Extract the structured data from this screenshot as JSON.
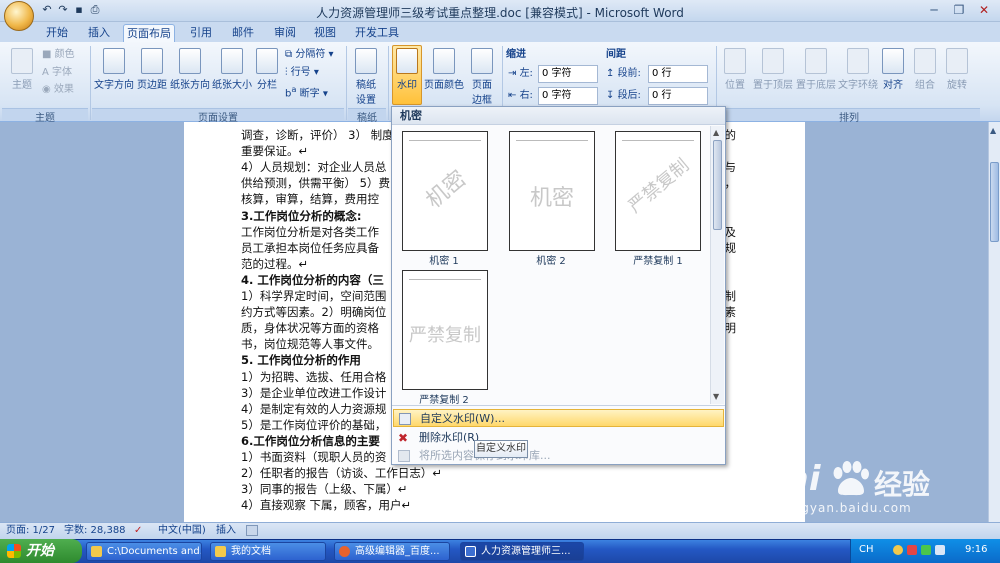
{
  "window": {
    "title": "人力资源管理师三级考试重点整理.doc [兼容模式] - Microsoft Word"
  },
  "qat": {
    "undo": "↶",
    "redo": "↷",
    "save": "▪",
    "print": "⎙"
  },
  "tabs": [
    "开始",
    "插入",
    "页面布局",
    "引用",
    "邮件",
    "审阅",
    "视图",
    "开发工具"
  ],
  "ribbon": {
    "theme": {
      "label": "主题",
      "colors": "颜色",
      "fonts": "字体",
      "effects": "效果",
      "group": "主题"
    },
    "page_setup": {
      "text_dir": "文字方向",
      "margins": "页边距",
      "orientation": "纸张方向",
      "size": "纸张大小",
      "columns": "分栏",
      "breaks": "分隔符",
      "line_numbers": "行号",
      "hyphenation": "断字",
      "group": "页面设置"
    },
    "manuscript": {
      "settings": "稿纸\n设置",
      "group": "稿纸"
    },
    "background": {
      "watermark": "水印",
      "page_color": "页面颜色",
      "page_border": "页面\n边框"
    },
    "paragraph": {
      "indent_label": "缩进",
      "left": "左:",
      "left_value": "0 字符",
      "right": "右:",
      "right_value": "0 字符",
      "spacing_label": "间距",
      "before": "段前:",
      "before_value": "0 行",
      "after": "段后:",
      "after_value": "0 行"
    },
    "arrange": {
      "position": "位置",
      "bring_front": "置于顶层",
      "send_back": "置于底层",
      "text_wrap": "文字环绕",
      "align": "对齐",
      "group_btn": "组合",
      "rotate": "旋转",
      "group": "排列"
    }
  },
  "document": {
    "lines": [
      {
        "text": "调查，诊断，评价） 3） 制度",
        "tail": "规的",
        "bold": false
      },
      {
        "text": "重要保证。↵",
        "tail": "",
        "bold": false
      },
      {
        "text": "4）人员规划：对企业人员总",
        "tail": "求与",
        "bold": false
      },
      {
        "text": "供给预测，供需平衡） 5）费",
        "tail": "算，",
        "bold": false
      },
      {
        "text": "核算，审算，结算，费用控",
        "tail": "",
        "bold": false
      },
      {
        "text": "3.工作岗位分析的概念:",
        "tail": "",
        "bold": true
      },
      {
        "text": " 工作岗位分析是对各类工作",
        "tail": "以及",
        "bold": false
      },
      {
        "text": "员工承担本岗位任务应具备",
        "tail": "事规",
        "bold": false
      },
      {
        "text": "范的过程。↵",
        "tail": "",
        "bold": false
      },
      {
        "text": "4. 工作岗位分析的内容（三",
        "tail": "",
        "bold": true
      },
      {
        "text": "1）科学界定时间，空间范围",
        "tail": "和制",
        "bold": false
      },
      {
        "text": "约方式等因素。2）明确岗位",
        "tail": "理素",
        "bold": false
      },
      {
        "text": "质，身体状况等方面的资格",
        "tail": "说明",
        "bold": false
      },
      {
        "text": "书，岗位规范等人事文件。",
        "tail": "",
        "bold": false
      },
      {
        "text": "5. 工作岗位分析的作用",
        "tail": "",
        "bold": true
      },
      {
        "text": "1）为招聘、选拔、任用合格",
        "tail": "",
        "bold": false
      },
      {
        "text": "3）是企业单位改进工作设计",
        "tail": "",
        "bold": false
      },
      {
        "text": "4）是制定有效的人力资源规",
        "tail": "",
        "bold": false
      },
      {
        "text": "5）是工作岗位评价的基础，",
        "tail": "",
        "bold": false
      },
      {
        "text": "6.工作岗位分析信息的主要",
        "tail": "",
        "bold": true
      },
      {
        "text": "1）书面资料（现职人员的资",
        "tail": "",
        "bold": false
      },
      {
        "text": "2）任职者的报告（访谈、工作日志）↵",
        "tail": "",
        "bold": false
      },
      {
        "text": "3）同事的报告（上级、下属）↵",
        "tail": "",
        "bold": false
      },
      {
        "text": "4）直接观察          下属，顾客，用户↵",
        "tail": "",
        "bold": false
      }
    ]
  },
  "watermark_menu": {
    "header": "机密",
    "items": [
      {
        "caption": "机密 1",
        "watermark": "机密",
        "diagonal": true
      },
      {
        "caption": "机密 2",
        "watermark": "机密",
        "diagonal": false
      },
      {
        "caption": "严禁复制 1",
        "watermark": "严禁复制",
        "diagonal": true
      },
      {
        "caption": "严禁复制 2",
        "watermark": "严禁复制",
        "diagonal": false
      }
    ],
    "custom": "自定义水印(W)...",
    "remove": "删除水印(R)",
    "save_selection": "将所选内容保存到水印库..."
  },
  "tooltip": "自定义水印",
  "statusbar": {
    "page": "页面: 1/27",
    "words": "字数: 28,388",
    "lang": "中文(中国)",
    "mode": "插入"
  },
  "taskbar": {
    "start": "开始",
    "tasks": [
      {
        "label": "C:\\Documents and...",
        "color": "#f2c94c",
        "active": false
      },
      {
        "label": "我的文档",
        "color": "#f2c94c",
        "active": false
      },
      {
        "label": "高级编辑器_百度...",
        "color": "#e8622c",
        "active": false
      },
      {
        "label": "人力资源管理师三...",
        "color": "#3c6fd1",
        "active": true
      }
    ],
    "lang": "CH",
    "clock": "9:16"
  },
  "watermark_logo": {
    "brand": "Bai",
    "brand2": "经验",
    "url": "jingyan.baidu.com"
  }
}
